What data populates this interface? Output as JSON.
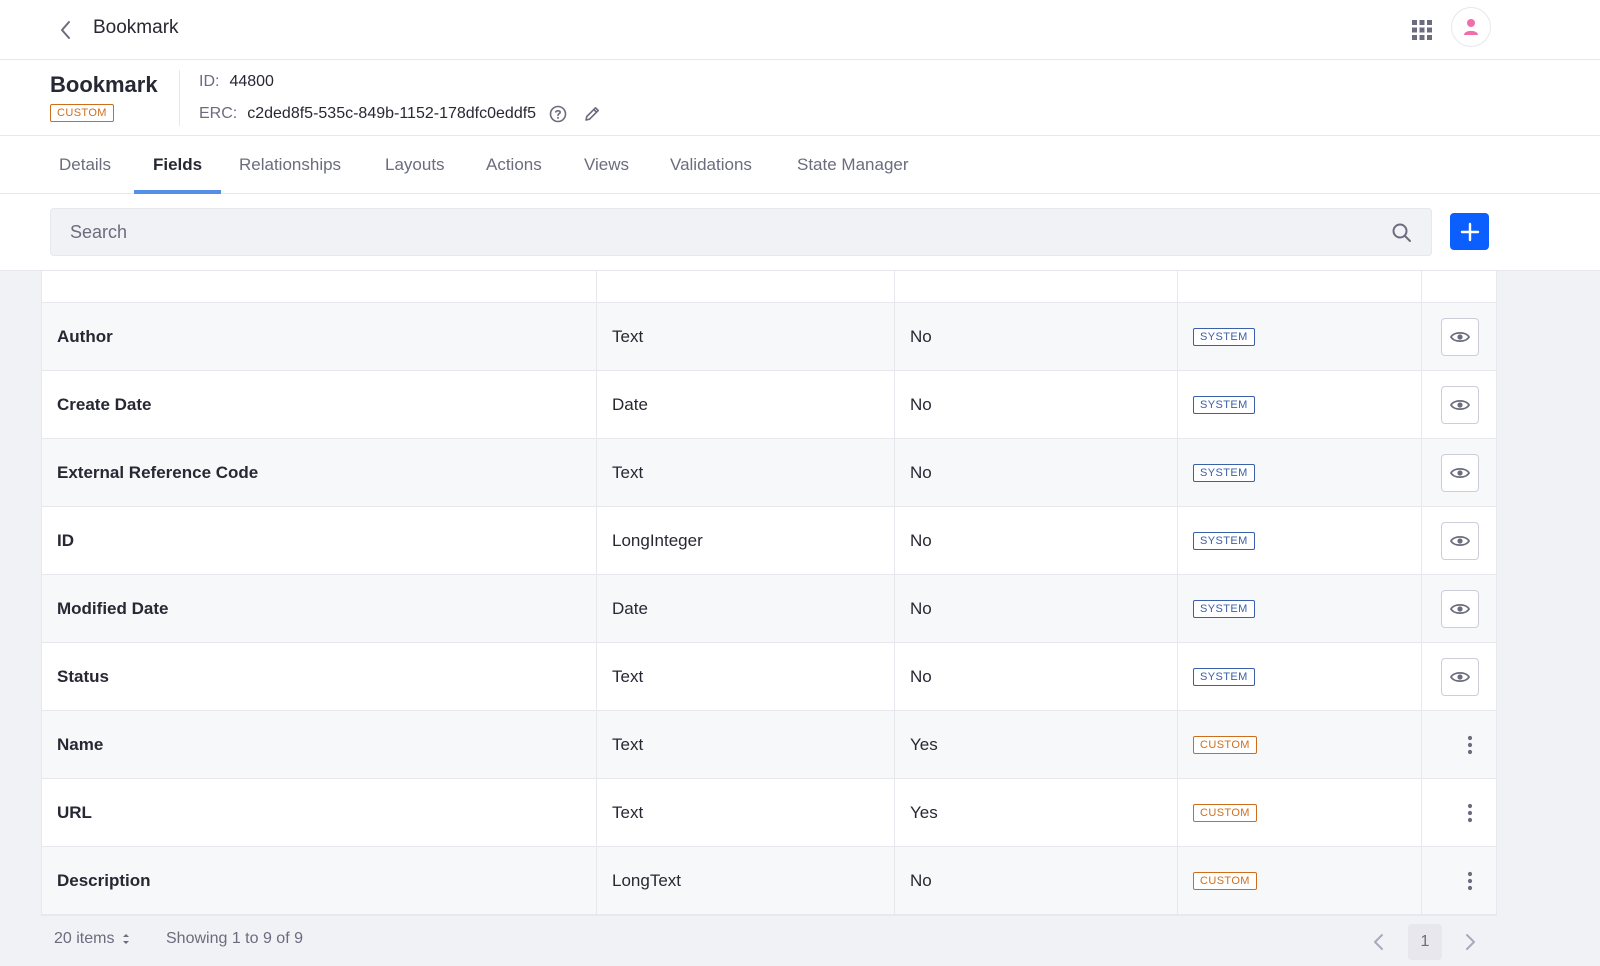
{
  "topbar": {
    "title": "Bookmark"
  },
  "header": {
    "title": "Bookmark",
    "badge": "CUSTOM",
    "id_label": "ID:",
    "id_value": "44800",
    "erc_label": "ERC:",
    "erc_value": "c2ded8f5-535c-849b-1152-178dfc0eddf5"
  },
  "tabs": [
    "Details",
    "Fields",
    "Relationships",
    "Layouts",
    "Actions",
    "Views",
    "Validations",
    "State Manager"
  ],
  "active_tab": "Fields",
  "search": {
    "placeholder": "Search"
  },
  "rows": [
    {
      "label": "Author",
      "type": "Text",
      "mandatory": "No",
      "source": "SYSTEM",
      "action": "view"
    },
    {
      "label": "Create Date",
      "type": "Date",
      "mandatory": "No",
      "source": "SYSTEM",
      "action": "view"
    },
    {
      "label": "External Reference Code",
      "type": "Text",
      "mandatory": "No",
      "source": "SYSTEM",
      "action": "view"
    },
    {
      "label": "ID",
      "type": "LongInteger",
      "mandatory": "No",
      "source": "SYSTEM",
      "action": "view"
    },
    {
      "label": "Modified Date",
      "type": "Date",
      "mandatory": "No",
      "source": "SYSTEM",
      "action": "view"
    },
    {
      "label": "Status",
      "type": "Text",
      "mandatory": "No",
      "source": "SYSTEM",
      "action": "view"
    },
    {
      "label": "Name",
      "type": "Text",
      "mandatory": "Yes",
      "source": "CUSTOM",
      "action": "menu"
    },
    {
      "label": "URL",
      "type": "Text",
      "mandatory": "Yes",
      "source": "CUSTOM",
      "action": "menu"
    },
    {
      "label": "Description",
      "type": "LongText",
      "mandatory": "No",
      "source": "CUSTOM",
      "action": "menu"
    }
  ],
  "pagination": {
    "per_page": "20 items",
    "showing": "Showing 1 to 9 of 9",
    "current_page": "1"
  },
  "colors": {
    "primary": "#0b5fff",
    "custom_label": "#ce6e1d",
    "system_label": "#3b5fa8",
    "tab_indicator": "#528fe5",
    "avatar": "#f06eaa"
  },
  "icons": [
    "chevron-left-icon",
    "apps-grid-icon",
    "user-icon",
    "help-icon",
    "pencil-icon",
    "search-icon",
    "plus-icon",
    "eye-icon",
    "ellipsis-v-icon",
    "caret-double-icon",
    "chevron-right-icon"
  ]
}
